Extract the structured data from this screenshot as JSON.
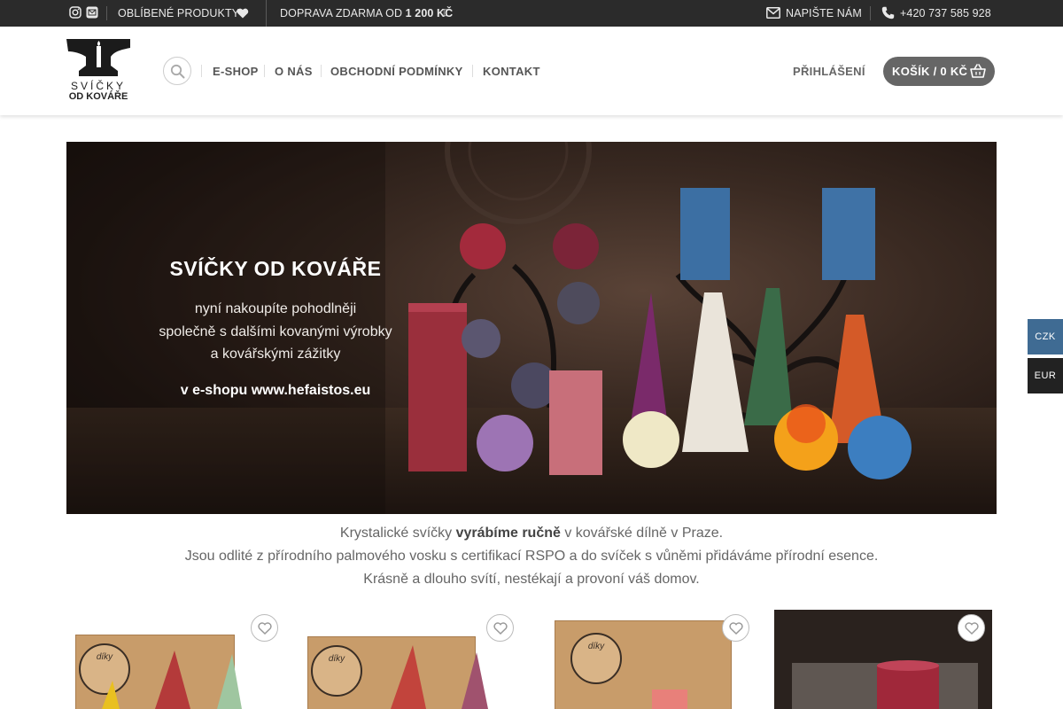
{
  "topbar": {
    "favorites_label": "OBLÍBENÉ PRODUKTY",
    "shipping_prefix": "DOPRAVA ZDARMA OD",
    "shipping_amount": "1 200 KČ",
    "contact_label": "NAPIŠTE NÁM",
    "phone": "+420 737 585 928"
  },
  "header": {
    "logo_top": "SVÍČKY",
    "logo_bottom": "OD KOVÁŘE",
    "nav": [
      "E-SHOP",
      "O NÁS",
      "OBCHODNÍ PODMÍNKY",
      "KONTAKT"
    ],
    "login_label": "PŘIHLÁŠENÍ",
    "cart_label": "KOŠÍK / 0 KČ"
  },
  "hero": {
    "title": "SVÍČKY OD KOVÁŘE",
    "lines": [
      "nyní nakoupíte pohodlněji",
      "společně s dalšími kovanými výrobky",
      "a kovářskými zážitky"
    ],
    "link_text": "v e-shopu www.hefaistos.eu"
  },
  "intro": {
    "line1_a": "Krystalické svíčky ",
    "line1_bold": "vyrábíme ručně",
    "line1_b": " v kovářské dílně v Praze.",
    "line2": "Jsou odlité z přírodního palmového vosku s certifikací RSPO a do svíček s vůněmi přidáváme přírodní esence.",
    "line3": "Krásně a dlouho svítí, nestékají a provoní váš domov."
  },
  "products": {
    "stamp_text": "díky"
  },
  "currency": {
    "options": [
      "CZK",
      "EUR"
    ],
    "selected": "CZK"
  },
  "colors": {
    "topbar_bg": "#2b2b2b",
    "cart_bg": "#666666",
    "czk_bg": "#3f6b93",
    "eur_bg": "#222222"
  }
}
